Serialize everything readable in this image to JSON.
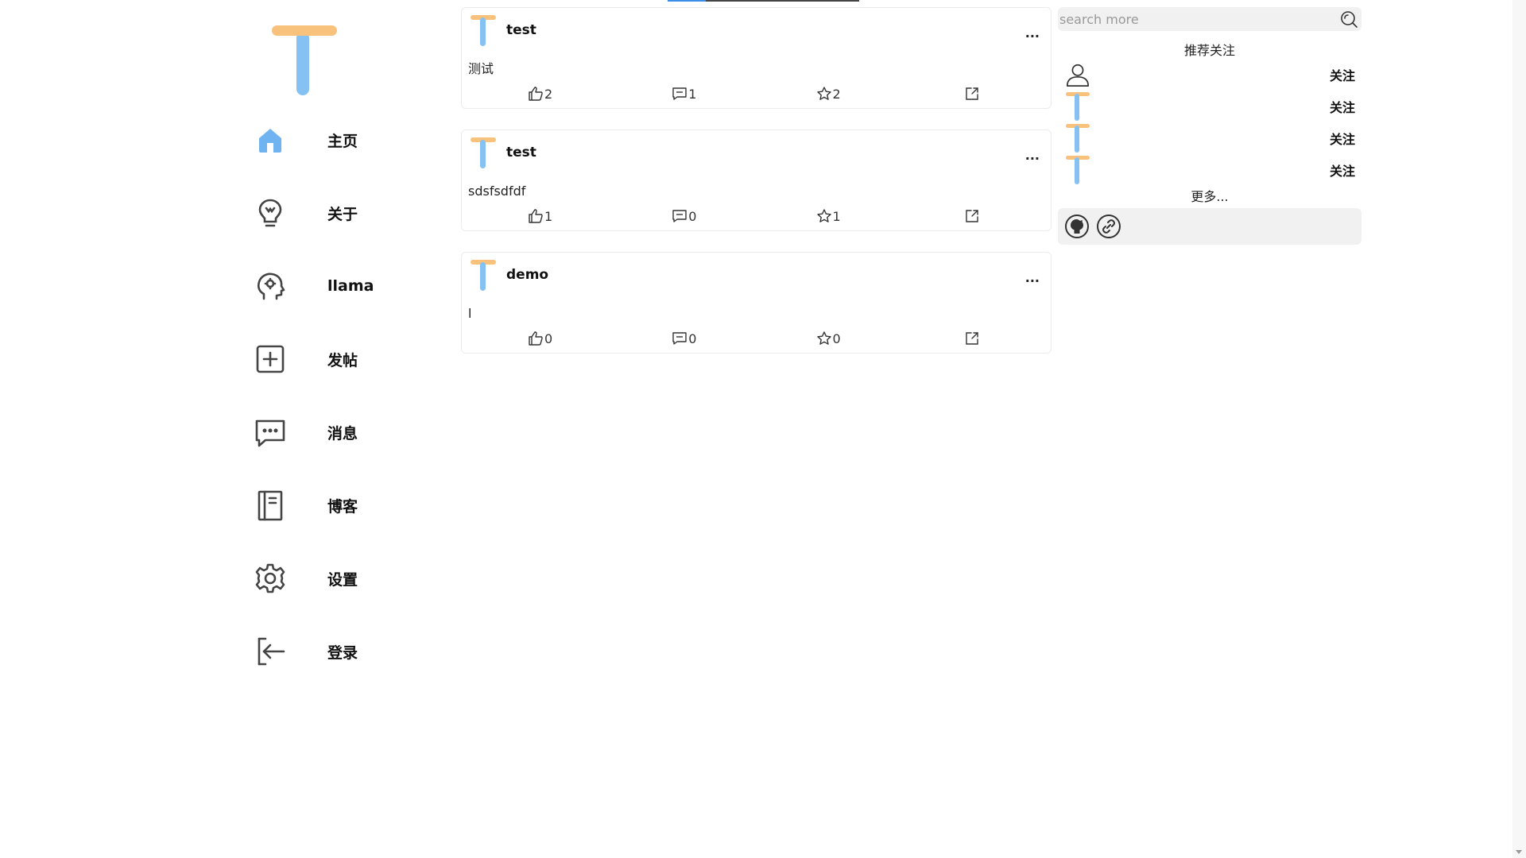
{
  "colors": {
    "accent": "#3b8ee8",
    "logo_orange": "#f8c27c",
    "logo_blue": "#85c1f2"
  },
  "sidebar": {
    "items": [
      {
        "label": "主页",
        "icon": "home-icon"
      },
      {
        "label": "关于",
        "icon": "lightbulb-icon"
      },
      {
        "label": "llama",
        "icon": "brain-head-icon"
      },
      {
        "label": "发帖",
        "icon": "plus-square-icon"
      },
      {
        "label": "消息",
        "icon": "message-icon"
      },
      {
        "label": "博客",
        "icon": "notebook-icon"
      },
      {
        "label": "设置",
        "icon": "gear-icon"
      },
      {
        "label": "登录",
        "icon": "login-icon"
      }
    ]
  },
  "feed": {
    "posts": [
      {
        "author": "test",
        "content": "测试",
        "more": "...",
        "likes": "2",
        "comments": "1",
        "stars": "2"
      },
      {
        "author": "test",
        "content": "sdsfsdfdf",
        "more": "...",
        "likes": "1",
        "comments": "0",
        "stars": "1"
      },
      {
        "author": "demo",
        "content": "l",
        "more": "...",
        "likes": "0",
        "comments": "0",
        "stars": "0"
      }
    ]
  },
  "right": {
    "search_placeholder": "search more",
    "rec_title": "推荐关注",
    "recommendations": [
      {
        "follow": "关注",
        "avatar": "user-outline-icon"
      },
      {
        "follow": "关注",
        "avatar": "t-logo-avatar"
      },
      {
        "follow": "关注",
        "avatar": "t-logo-avatar"
      },
      {
        "follow": "关注",
        "avatar": "t-logo-avatar"
      }
    ],
    "more": "更多..."
  }
}
